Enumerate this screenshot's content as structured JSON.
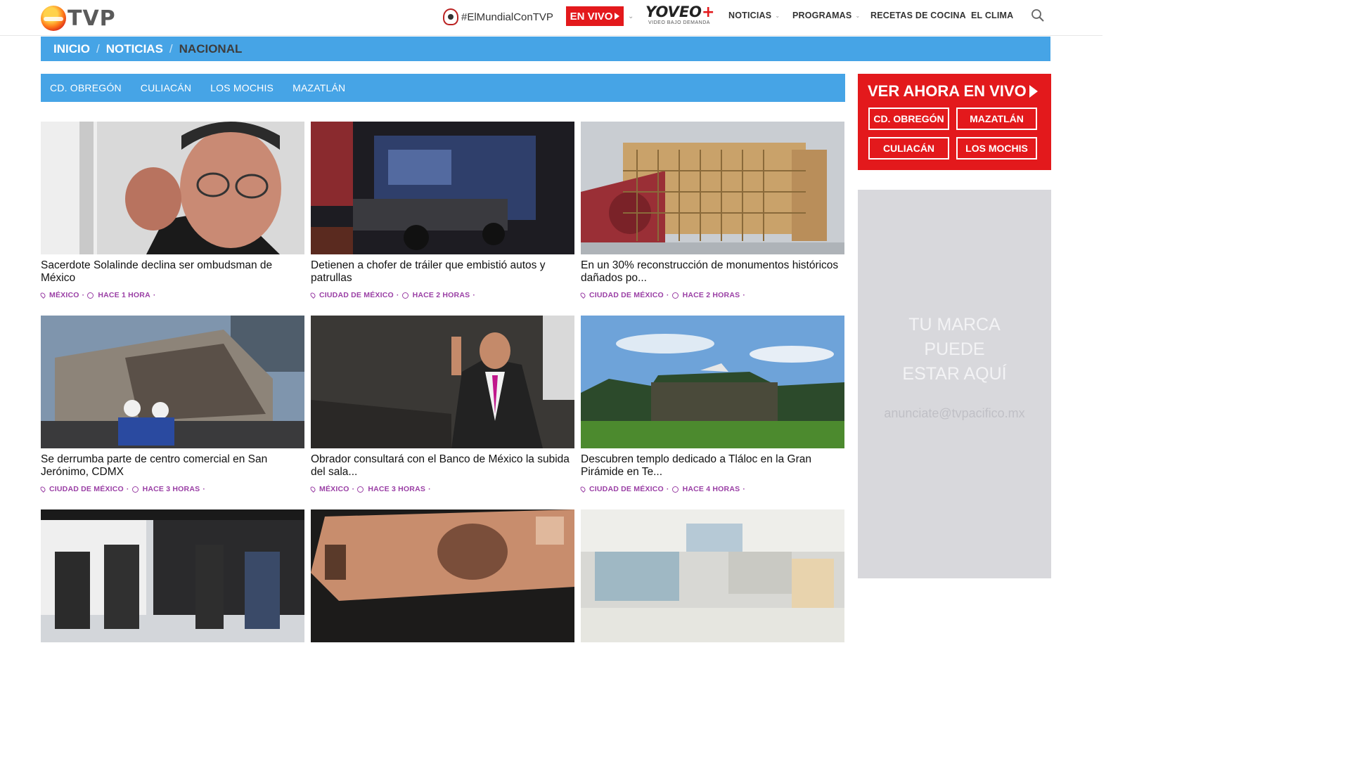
{
  "header": {
    "logo_text": "TVP",
    "hashtag": "#ElMundialConTVP",
    "live_label": "EN VIVO",
    "yoveo_main": "YOVEO",
    "yoveo_plus": "+",
    "yoveo_sub": "VIDEO BAJO DEMANDA",
    "nav": [
      {
        "label": "NOTICIAS"
      },
      {
        "label": "PROGRAMAS"
      },
      {
        "label": "RECETAS DE COCINA"
      },
      {
        "label": "EL CLIMA"
      }
    ]
  },
  "breadcrumb": {
    "items": [
      "INICIO",
      "NOTICIAS",
      "NACIONAL"
    ],
    "separator": "/"
  },
  "citybar": {
    "cities": [
      "CD. OBREGÓN",
      "CULIACÁN",
      "LOS MOCHIS",
      "MAZATLÁN"
    ]
  },
  "articles": [
    {
      "title": "Sacerdote Solalinde declina ser ombudsman de México",
      "location": "MÉXICO",
      "time": "HACE 1 HORA",
      "image": "portrait-man-fist"
    },
    {
      "title": "Detienen a chofer de tráiler que embistió autos y patrullas",
      "location": "CIUDAD DE MÉXICO",
      "time": "HACE 2 HORAS",
      "image": "crashed-truck-night"
    },
    {
      "title": "En un 30% reconstrucción de monumentos históricos dañados po...",
      "location": "CIUDAD DE MÉXICO",
      "time": "HACE 2 HORAS",
      "image": "church-scaffolding"
    },
    {
      "title": "Se derrumba parte de centro comercial en San Jerónimo, CDMX",
      "location": "CIUDAD DE MÉXICO",
      "time": "HACE 3 HORAS",
      "image": "collapsed-building"
    },
    {
      "title": "Obrador consultará con el Banco de México la subida del sala...",
      "location": "MÉXICO",
      "time": "HACE 3 HORAS",
      "image": "politician-wave"
    },
    {
      "title": "Descubren templo dedicado a Tláloc en la Gran Pirámide en Te...",
      "location": "CIUDAD DE MÉXICO",
      "time": "HACE 4 HORAS",
      "image": "pyramid-landscape"
    },
    {
      "title": "",
      "location": "",
      "time": "",
      "image": "police-trucks"
    },
    {
      "title": "",
      "location": "",
      "time": "",
      "image": "banknote-500"
    },
    {
      "title": "",
      "location": "",
      "time": "",
      "image": "hospital-room"
    }
  ],
  "sidebar": {
    "live_title": "VER AHORA EN VIVO",
    "live_buttons": [
      "CD. OBREGÓN",
      "MAZATLÁN",
      "CULIACÁN",
      "LOS MOCHIS"
    ],
    "ad_lines": [
      "TU MARCA",
      "PUEDE",
      "ESTAR AQUÍ"
    ],
    "ad_email": "anunciate@tvpacifico.mx"
  },
  "colors": {
    "accent_blue": "#46a4e6",
    "live_red": "#e3191c",
    "meta_purple": "#9a3fa5"
  }
}
